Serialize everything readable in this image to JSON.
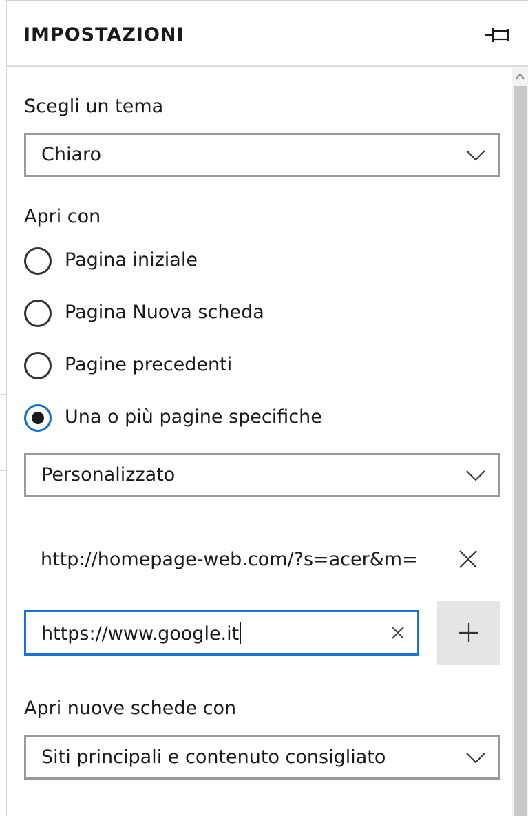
{
  "panel": {
    "title": "IMPOSTAZIONI"
  },
  "theme": {
    "label": "Scegli un tema",
    "selected": "Chiaro"
  },
  "open_with": {
    "label": "Apri con",
    "options": [
      {
        "label": "Pagina iniziale",
        "checked": false
      },
      {
        "label": "Pagina Nuova scheda",
        "checked": false
      },
      {
        "label": "Pagine precedenti",
        "checked": false
      },
      {
        "label": "Una o più pagine specifiche",
        "checked": true
      }
    ],
    "pages_mode": "Personalizzato"
  },
  "pages": {
    "existing_url": "http://homepage-web.com/?s=acer&m=",
    "input_value": "https://www.google.it"
  },
  "new_tabs": {
    "label": "Apri nuove schede con",
    "selected": "Siti principali e contenuto consigliato"
  },
  "colors": {
    "accent": "#1a73d4",
    "button_bg": "#e5e5e5",
    "scroll_thumb": "#c8c8c8"
  },
  "icons": {
    "pin": "pin-icon",
    "chevron": "chevron-down-icon",
    "remove": "close-icon",
    "clear": "clear-icon",
    "add": "plus-icon"
  }
}
